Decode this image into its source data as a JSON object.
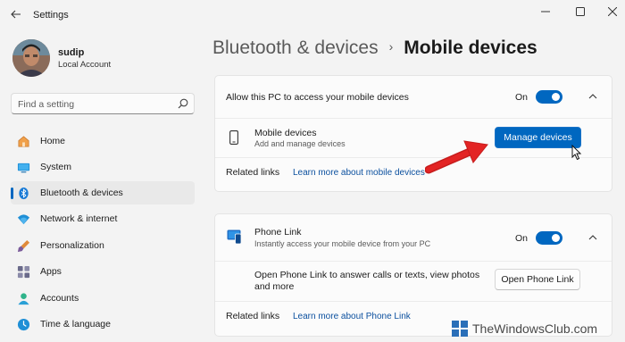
{
  "window": {
    "title": "Settings",
    "back_icon": "back-arrow-icon",
    "controls": [
      "minimize-icon",
      "maximize-icon",
      "close-icon"
    ]
  },
  "profile": {
    "name": "sudip",
    "account": "Local Account"
  },
  "search": {
    "placeholder": "Find a setting",
    "icon": "search-icon"
  },
  "sidebar": {
    "items": [
      {
        "label": "Home",
        "icon": "home-icon",
        "active": false
      },
      {
        "label": "System",
        "icon": "system-icon",
        "active": false
      },
      {
        "label": "Bluetooth & devices",
        "icon": "bluetooth-icon",
        "active": true
      },
      {
        "label": "Network & internet",
        "icon": "wifi-icon",
        "active": false
      },
      {
        "label": "Personalization",
        "icon": "brush-icon",
        "active": false
      },
      {
        "label": "Apps",
        "icon": "apps-icon",
        "active": false
      },
      {
        "label": "Accounts",
        "icon": "accounts-icon",
        "active": false
      },
      {
        "label": "Time & language",
        "icon": "time-icon",
        "active": false
      }
    ]
  },
  "header": {
    "parent": "Bluetooth & devices",
    "current": "Mobile devices"
  },
  "mobile_card": {
    "allow_label": "Allow this PC to access your mobile devices",
    "toggle_state": "On",
    "row_title": "Mobile devices",
    "row_subtitle": "Add and manage devices",
    "manage_button": "Manage devices",
    "related_label": "Related links",
    "related_link": "Learn more about mobile devices"
  },
  "phone_link_card": {
    "title": "Phone Link",
    "subtitle": "Instantly access your mobile device from your PC",
    "toggle_state": "On",
    "open_text_line1": "Open Phone Link to answer calls or texts, view photos",
    "open_text_line2": "and more",
    "open_button": "Open Phone Link",
    "related_label": "Related links",
    "related_link": "Learn more about Phone Link"
  },
  "annotation": {
    "arrow_color": "#e32424"
  },
  "watermark": {
    "text": "TheWindowsClub.com"
  },
  "colors": {
    "accent": "#0067c0",
    "background": "#f3f3f3",
    "card": "#fbfbfb",
    "link": "#0a4f9e"
  }
}
